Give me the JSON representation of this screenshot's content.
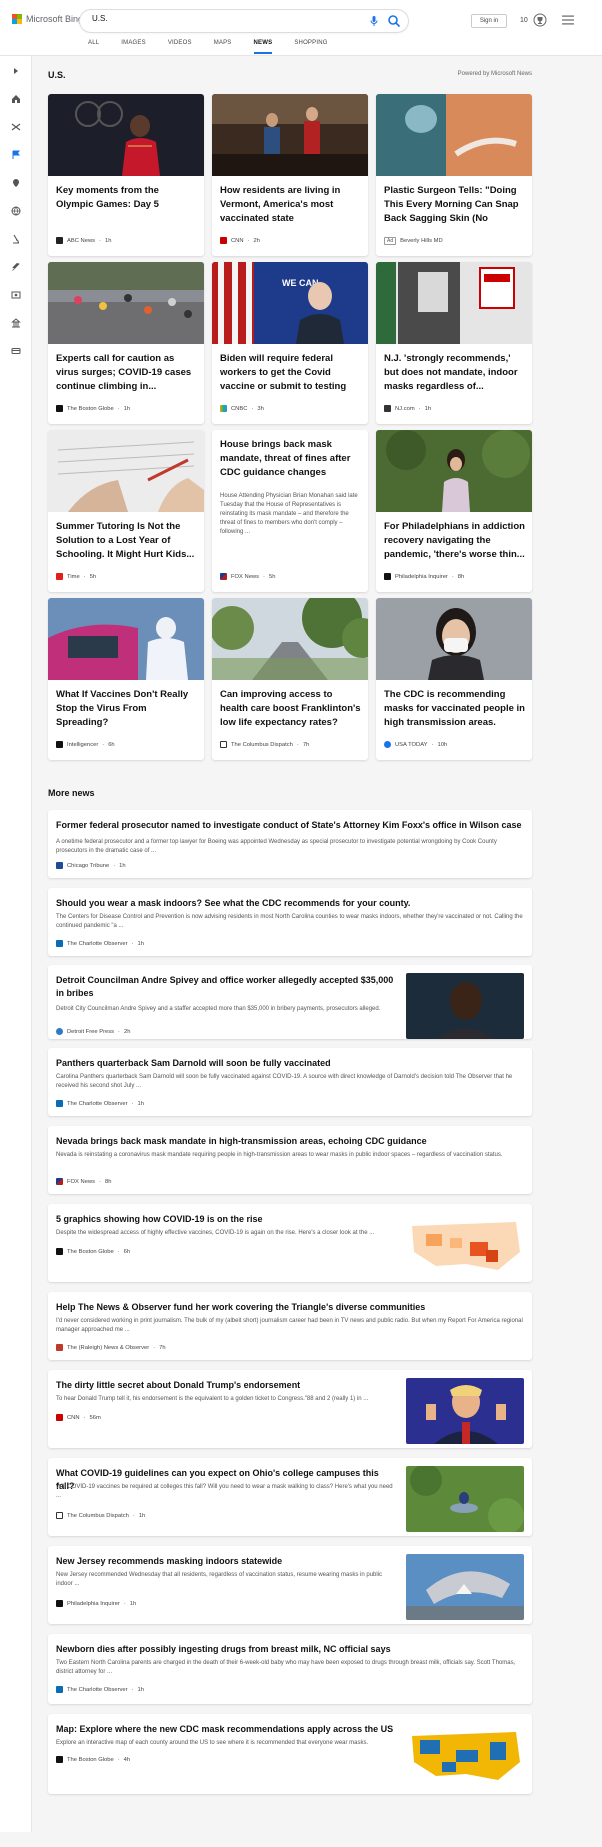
{
  "header": {
    "brand": "Microsoft Bing",
    "search_value": "U.S.",
    "signin_label": "Sign in",
    "rewards_count": "10",
    "tabs": [
      {
        "label": "ALL"
      },
      {
        "label": "IMAGES"
      },
      {
        "label": "VIDEOS"
      },
      {
        "label": "MAPS"
      },
      {
        "label": "NEWS"
      },
      {
        "label": "SHOPPING"
      }
    ]
  },
  "section": {
    "title": "U.S.",
    "powered_by": "Powered by Microsoft News"
  },
  "cards": [
    {
      "title": "Key moments from the Olympic Games: Day 5",
      "source": "ABC News",
      "age": "1h"
    },
    {
      "title": "How residents are living in Vermont, America's most vaccinated state",
      "source": "CNN",
      "age": "2h"
    },
    {
      "title": "Plastic Surgeon Tells: \"Doing This Every Morning Can Snap Back Sagging Skin (No Cream...",
      "ad": "Ad",
      "source": "Beverly Hills MD"
    },
    {
      "title": "Experts call for caution as virus surges; COVID-19 cases continue climbing in...",
      "source": "The Boston Globe",
      "age": "1h"
    },
    {
      "title": "Biden will require federal workers to get the Covid vaccine or submit to testing",
      "source": "CNBC",
      "age": "3h"
    },
    {
      "title": "N.J. 'strongly recommends,' but does not mandate, indoor masks regardless of...",
      "source": "NJ.com",
      "age": "1h"
    },
    {
      "title": "Summer Tutoring Is Not the Solution to a Lost Year of Schooling. It Might Hurt Kids...",
      "source": "Time",
      "age": "5h"
    },
    {
      "title": "House brings back mask mandate, threat of fines after CDC guidance changes",
      "snippet": "House Attending Physician Brian Monahan said late Tuesday that the House of Representatives is reinstating its mask mandate – and therefore the threat of fines to members who don't comply – following ...",
      "source": "FOX News",
      "age": "5h"
    },
    {
      "title": "For Philadelphians in addiction recovery navigating the pandemic, 'there's worse thin...",
      "source": "Philadelphia Inquirer",
      "age": "8h"
    },
    {
      "title": "What If Vaccines Don't Really Stop the Virus From Spreading?",
      "source": "Intelligencer",
      "age": "6h"
    },
    {
      "title": "Can improving access to health care boost Franklinton's low life expectancy rates?",
      "source": "The Columbus Dispatch",
      "age": "7h"
    },
    {
      "title": "The CDC is recommending masks for vaccinated people in high transmission areas. Wha...",
      "source": "USA TODAY",
      "age": "10h"
    }
  ],
  "more_news": {
    "title": "More news",
    "items": [
      {
        "title": "Former federal prosecutor named to investigate conduct of State's Attorney Kim Foxx's office in Wilson case",
        "snippet": "A onetime federal prosecutor and a former top lawyer for Boeing was appointed Wednesday as special prosecutor to investigate potential wrongdoing by Cook County prosecutors in the dramatic case of ...",
        "source": "Chicago Tribune",
        "age": "1h"
      },
      {
        "title": "Should you wear a mask indoors? See what the CDC recommends for your county.",
        "snippet": "The Centers for Disease Control and Prevention is now advising residents in most North Carolina counties to wear masks indoors, whether they're vaccinated or not. Calling the continued pandemic \"a ...",
        "source": "The Charlotte Observer",
        "age": "1h"
      },
      {
        "title": "Detroit Councilman Andre Spivey and office worker allegedly accepted $35,000 in bribes",
        "snippet": "Detroit City Councilman Andre Spivey and a staffer accepted more than $35,000 in bribery payments, prosecutors alleged.",
        "source": "Detroit Free Press",
        "age": "2h"
      },
      {
        "title": "Panthers quarterback Sam Darnold will soon be fully vaccinated",
        "snippet": "Carolina Panthers quarterback Sam Darnold will soon be fully vaccinated against COVID-19. A source with direct knowledge of Darnold's decision told The Observer that he received his second shot July ...",
        "source": "The Charlotte Observer",
        "age": "1h"
      },
      {
        "title": "Nevada brings back mask mandate in high-transmission areas, echoing CDC guidance",
        "snippet": "Nevada is reinstating a coronavirus mask mandate requiring people in high-transmission areas to wear masks in public indoor spaces – regardless of vaccination status.",
        "source": "FOX News",
        "age": "8h"
      },
      {
        "title": "5 graphics showing how COVID-19 is on the rise",
        "snippet": "Despite the widespread access of highly effective vaccines, COVID-19 is again on the rise. Here's a closer look at the ...",
        "source": "The Boston Globe",
        "age": "6h"
      },
      {
        "title": "Help The News & Observer fund her work covering the Triangle's diverse communities",
        "snippet": "I'd never considered working in print journalism. The bulk of my (albeit short) journalism career had been in TV news and public radio. But when my Report For America regional manager approached me ...",
        "source": "The (Raleigh) News & Observer",
        "age": "7h"
      },
      {
        "title": "The dirty little secret about Donald Trump's endorsement",
        "snippet": "To hear Donald Trump tell it, his endorsement is the equivalent to a golden ticket to Congress.\"88 and 2 (really 1) in ...",
        "source": "CNN",
        "age": "56m"
      },
      {
        "title": "What COVID-19 guidelines can you expect on Ohio's college campuses this fall?",
        "snippet": "Will COVID-19 vaccines be required at colleges this fall? Will you need to wear a mask walking to class? Here's what you need ...",
        "source": "The Columbus Dispatch",
        "age": "1h"
      },
      {
        "title": "New Jersey recommends masking indoors statewide",
        "snippet": "New Jersey recommended Wednesday that all residents, regardless of vaccination status, resume wearing masks in public indoor ...",
        "source": "Philadelphia Inquirer",
        "age": "1h"
      },
      {
        "title": "Newborn dies after possibly ingesting drugs from breast milk, NC official says",
        "snippet": "Two Eastern North Carolina parents are charged in the death of their 6-week-old baby who may have been exposed to drugs through breast milk, officials say. Scott Thomas, district attorney for ...",
        "source": "The Charlotte Observer",
        "age": "1h"
      },
      {
        "title": "Map: Explore where the new CDC mask recommendations apply across the US",
        "snippet": "Explore an interactive map of each county around the US to see where it is recommended that everyone wear masks.",
        "source": "The Boston Globe",
        "age": "4h"
      }
    ]
  },
  "colors": {
    "accent": "#1a73e8",
    "ms_red": "#f25022",
    "ms_green": "#7fba00",
    "ms_blue": "#00a4ef",
    "ms_yellow": "#ffb900"
  }
}
